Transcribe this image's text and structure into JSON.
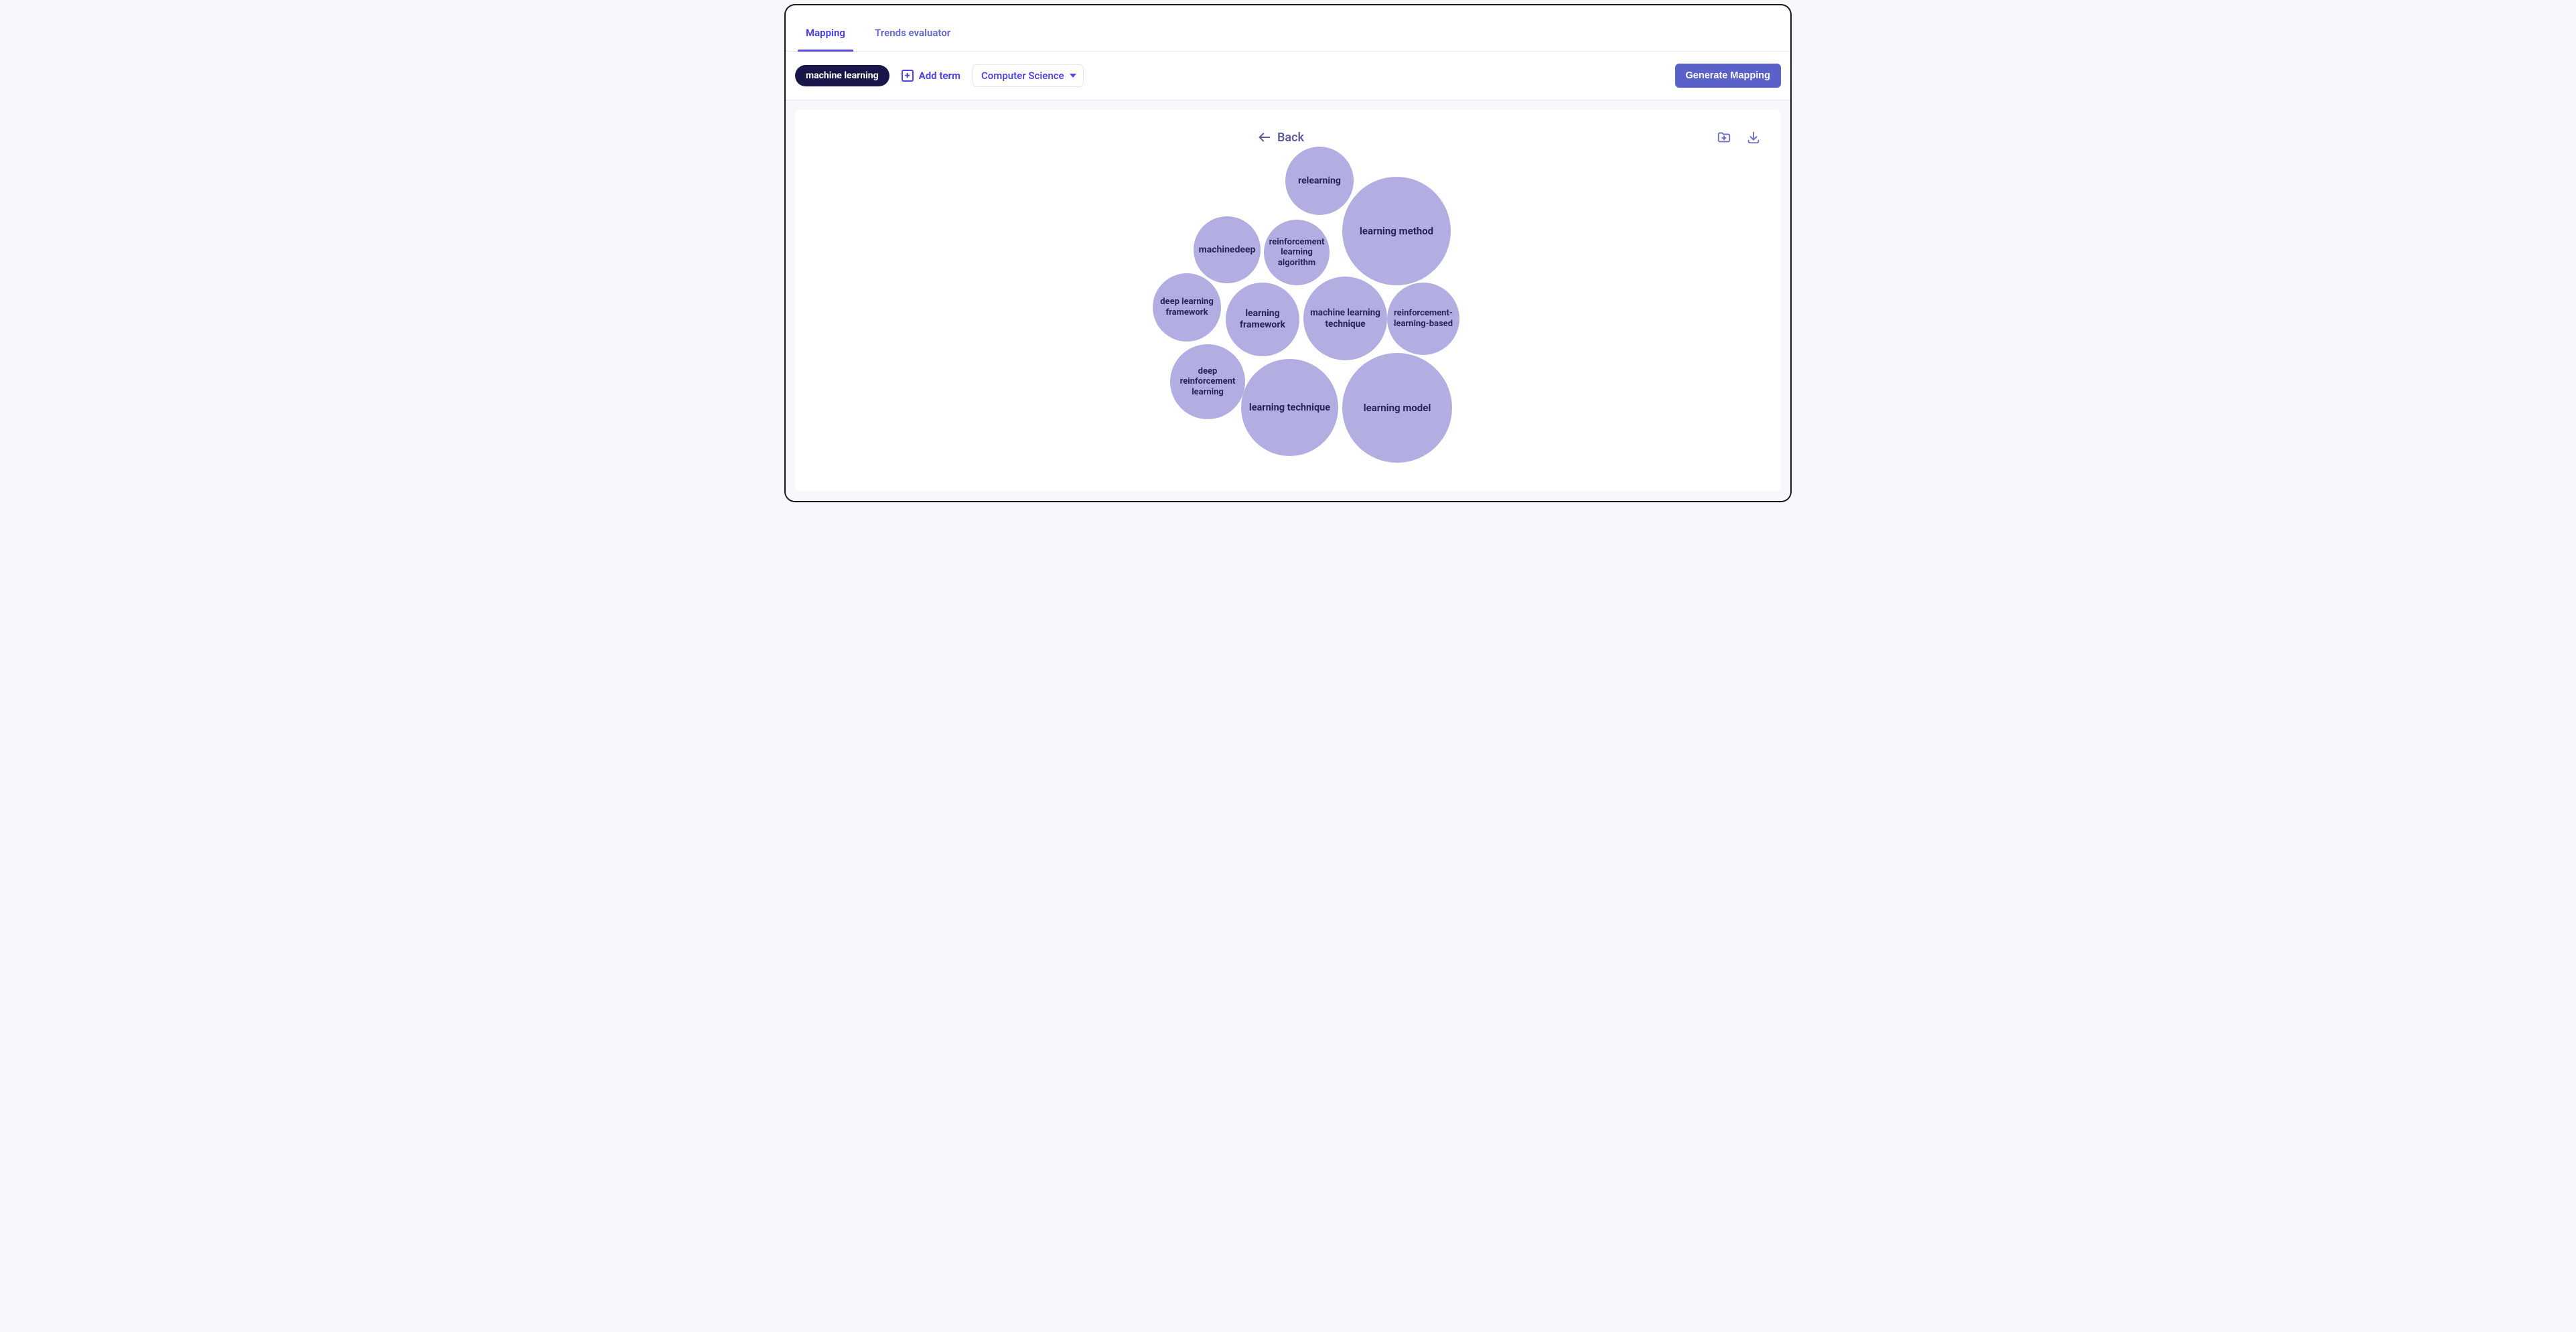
{
  "tabs": [
    {
      "label": "Mapping",
      "active": true
    },
    {
      "label": "Trends evaluator",
      "active": false
    }
  ],
  "toolbar": {
    "term_chip": "machine learning",
    "add_term_label": "Add term",
    "category_selected": "Computer Science",
    "generate_label": "Generate Mapping"
  },
  "canvas": {
    "back_label": "Back"
  },
  "chart_data": {
    "type": "packed-bubble",
    "bubbles": [
      {
        "label": "relearning",
        "size": 102
      },
      {
        "label": "learning method",
        "size": 162
      },
      {
        "label": "reinforcement learning algorithm",
        "size": 98
      },
      {
        "label": "machinedeep",
        "size": 100
      },
      {
        "label": "deep learning framework",
        "size": 102
      },
      {
        "label": "learning framework",
        "size": 110
      },
      {
        "label": "machine learning technique",
        "size": 125
      },
      {
        "label": "reinforcement-learning-based",
        "size": 108
      },
      {
        "label": "deep reinforcement learning",
        "size": 112
      },
      {
        "label": "learning technique",
        "size": 145
      },
      {
        "label": "learning model",
        "size": 164
      }
    ]
  }
}
